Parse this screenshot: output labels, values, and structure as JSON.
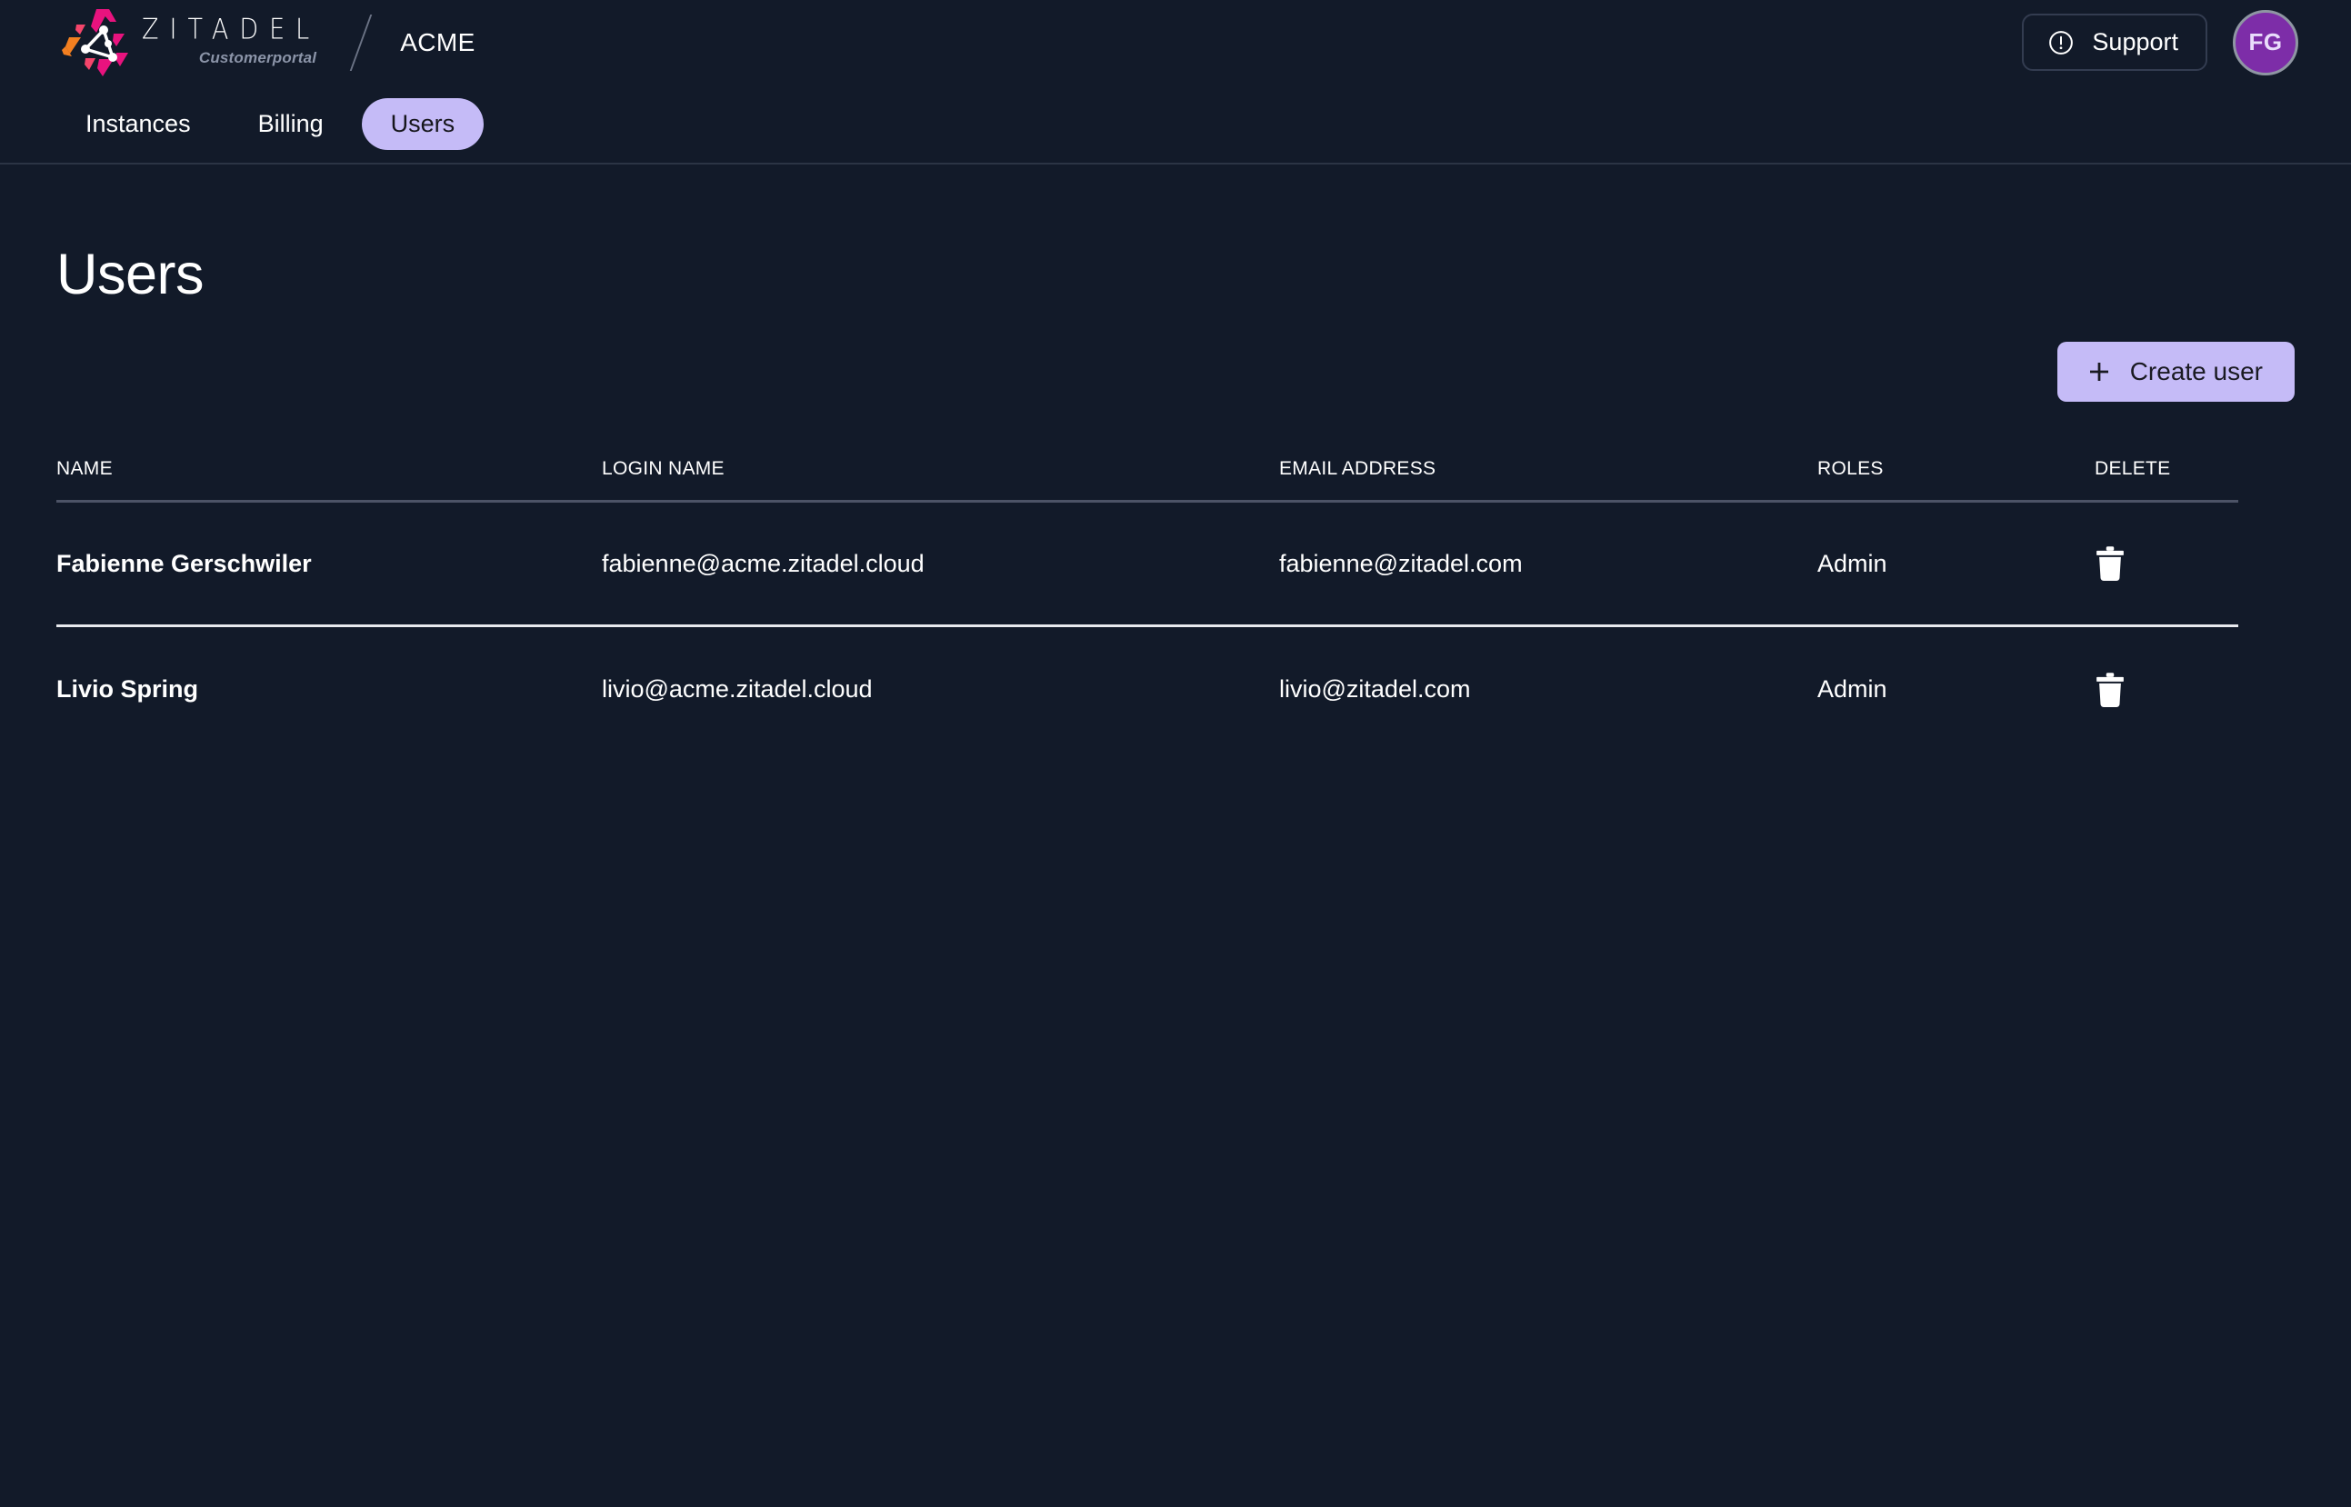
{
  "header": {
    "logo_icon": "zitadel-logo-icon",
    "wordmark": "ZITADEL",
    "subwordmark": "Customerportal",
    "separator": "slash-separator",
    "org_name": "ACME",
    "support_label": "Support",
    "support_icon": "info-circle-icon",
    "avatar_initials": "FG"
  },
  "nav": {
    "tabs": [
      {
        "label": "Instances",
        "active": false
      },
      {
        "label": "Billing",
        "active": false
      },
      {
        "label": "Users",
        "active": true
      }
    ]
  },
  "main": {
    "title": "Users",
    "create_button": {
      "label": "Create user",
      "icon": "plus-icon"
    },
    "table": {
      "columns": [
        "NAME",
        "LOGIN NAME",
        "EMAIL ADDRESS",
        "ROLES",
        "DELETE"
      ],
      "rows": [
        {
          "name": "Fabienne Gerschwiler",
          "login_name": "fabienne@acme.zitadel.cloud",
          "email": "fabienne@zitadel.com",
          "roles": "Admin",
          "delete_icon": "trash-icon"
        },
        {
          "name": "Livio Spring",
          "login_name": "livio@acme.zitadel.cloud",
          "email": "livio@zitadel.com",
          "roles": "Admin",
          "delete_icon": "trash-icon"
        }
      ]
    }
  },
  "colors": {
    "background": "#121a29",
    "accent": "#c5bbf7",
    "avatar_bg": "#7d2da8",
    "text_primary": "#ffffff",
    "muted": "#8b94a8",
    "row_divider": "#e8eaee",
    "header_divider": "#4c5366"
  }
}
